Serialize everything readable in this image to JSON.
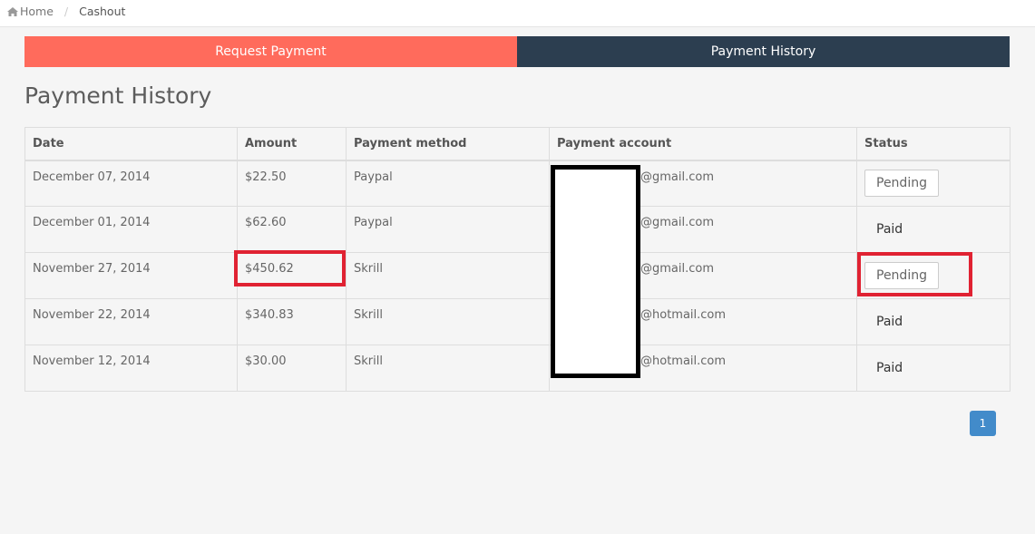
{
  "breadcrumb": {
    "home_label": "Home",
    "current_label": "Cashout"
  },
  "tabs": [
    {
      "label": "Request Payment"
    },
    {
      "label": "Payment History"
    }
  ],
  "page_title": "Payment History",
  "table": {
    "headers": [
      "Date",
      "Amount",
      "Payment method",
      "Payment account",
      "Status"
    ],
    "rows": [
      {
        "date": "December 07, 2014",
        "amount": "$22.50",
        "method": "Paypal",
        "account": "@gmail.com",
        "status": "Pending"
      },
      {
        "date": "December 01, 2014",
        "amount": "$62.60",
        "method": "Paypal",
        "account": "@gmail.com",
        "status": "Paid"
      },
      {
        "date": "November 27, 2014",
        "amount": "$450.62",
        "method": "Skrill",
        "account": "@gmail.com",
        "status": "Pending"
      },
      {
        "date": "November 22, 2014",
        "amount": "$340.83",
        "method": "Skrill",
        "account": "@hotmail.com",
        "status": "Paid"
      },
      {
        "date": "November 12, 2014",
        "amount": "$30.00",
        "method": "Skrill",
        "account": "@hotmail.com",
        "status": "Paid"
      }
    ]
  },
  "pagination": {
    "current_page": "1"
  },
  "colors": {
    "request_tab": "#ff6b5c",
    "history_tab": "#2c3e50",
    "highlight": "#e02232",
    "page_button": "#428bca"
  }
}
